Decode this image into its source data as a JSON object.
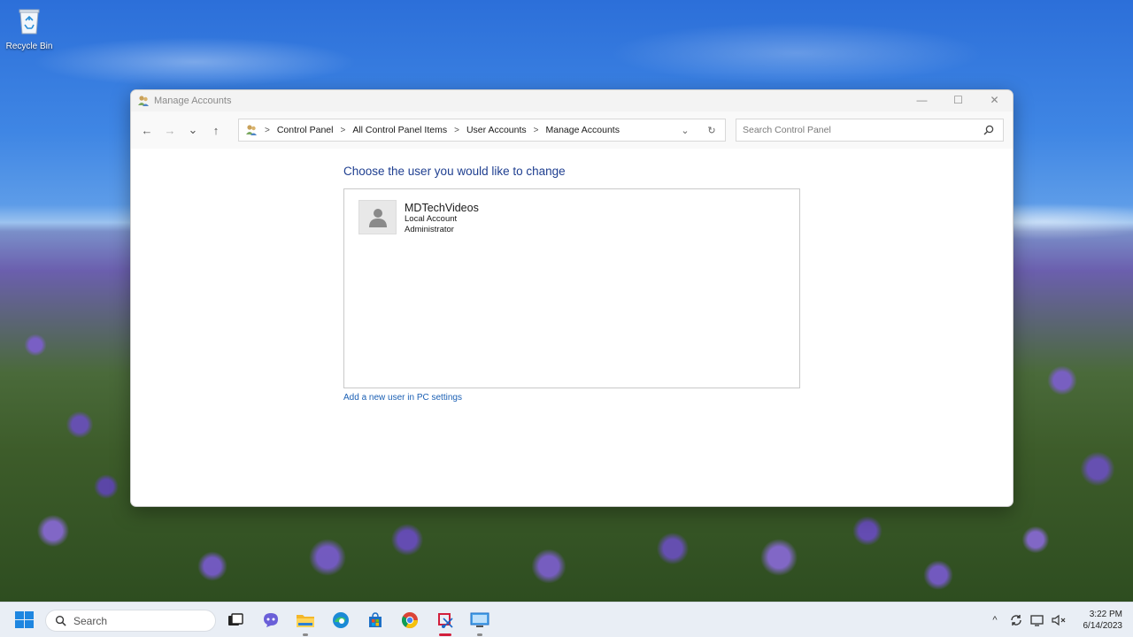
{
  "desktop": {
    "recycle_bin_label": "Recycle Bin"
  },
  "window": {
    "title": "Manage Accounts",
    "controls": {
      "minimize": "—",
      "maximize": "☐",
      "close": "✕"
    }
  },
  "navigation": {
    "back": "←",
    "forward": "→",
    "recent": "⌄",
    "up": "↑",
    "breadcrumb": [
      "Control Panel",
      "All Control Panel Items",
      "User Accounts",
      "Manage Accounts"
    ],
    "dropdown": "⌄",
    "refresh": "↻",
    "search_placeholder": "Search Control Panel"
  },
  "content": {
    "heading": "Choose the user you would like to change",
    "users": [
      {
        "name": "MDTechVideos",
        "type": "Local Account",
        "role": "Administrator"
      }
    ],
    "add_user_link": "Add a new user in PC settings"
  },
  "taskbar": {
    "search_label": "Search",
    "apps": [
      "task-view",
      "chat",
      "file-explorer",
      "edge",
      "store",
      "chrome",
      "snipping-tool",
      "remote-desktop"
    ],
    "tray": {
      "chevron": "^",
      "time": "3:22 PM",
      "date": "6/14/2023"
    }
  },
  "colors": {
    "link": "#1a5fb4",
    "heading": "#1f3f90",
    "taskbar": "#e9eef5"
  }
}
